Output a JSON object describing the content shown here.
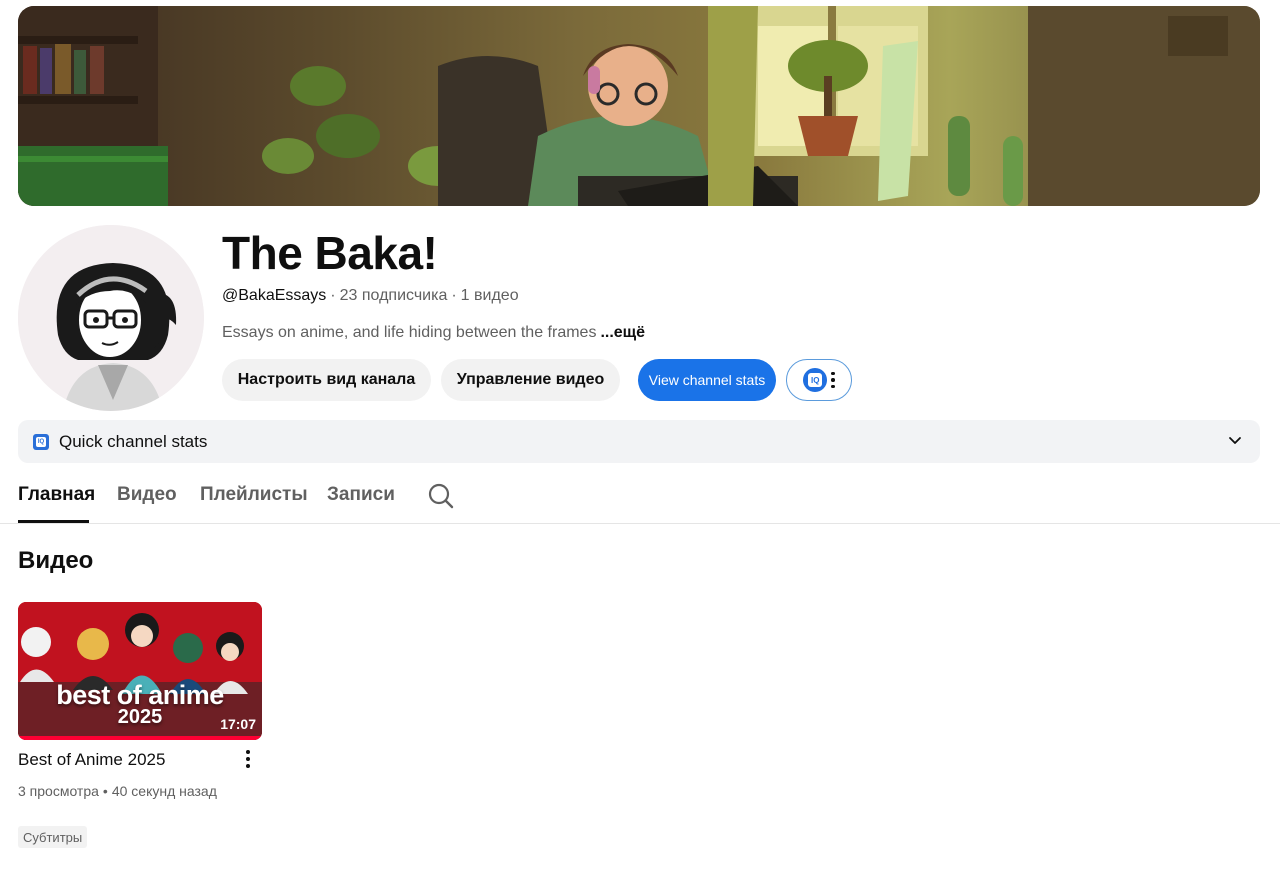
{
  "channel": {
    "name": "The Baka!",
    "handle": "@BakaEssays",
    "subscribers": "23 подписчика",
    "video_count": "1 видео",
    "description": "Essays on anime, and life hiding between the frames",
    "more_label": "...ещё"
  },
  "actions": {
    "customize_label": "Настроить вид канала",
    "manage_label": "Управление видео",
    "stats_label": "View channel stats",
    "extension_icon": "iq-icon"
  },
  "quick_stats": {
    "label": "Quick channel stats",
    "icon_text": "IQ"
  },
  "tabs": [
    {
      "label": "Главная",
      "active": true
    },
    {
      "label": "Видео",
      "active": false
    },
    {
      "label": "Плейлисты",
      "active": false
    },
    {
      "label": "Записи",
      "active": false
    }
  ],
  "section": {
    "title": "Видео"
  },
  "videos": [
    {
      "title": "Best of Anime 2025",
      "thumbnail_line1": "best of anime",
      "thumbnail_line2": "2025",
      "duration": "17:07",
      "views": "3 просмотра",
      "age": "40 секунд назад",
      "badge": "Субтитры",
      "watched_fraction": 1.0
    }
  ],
  "colors": {
    "accent_blue": "#1a73e8",
    "progress_red": "#ff0033",
    "thumbnail_red": "#c1121f"
  }
}
